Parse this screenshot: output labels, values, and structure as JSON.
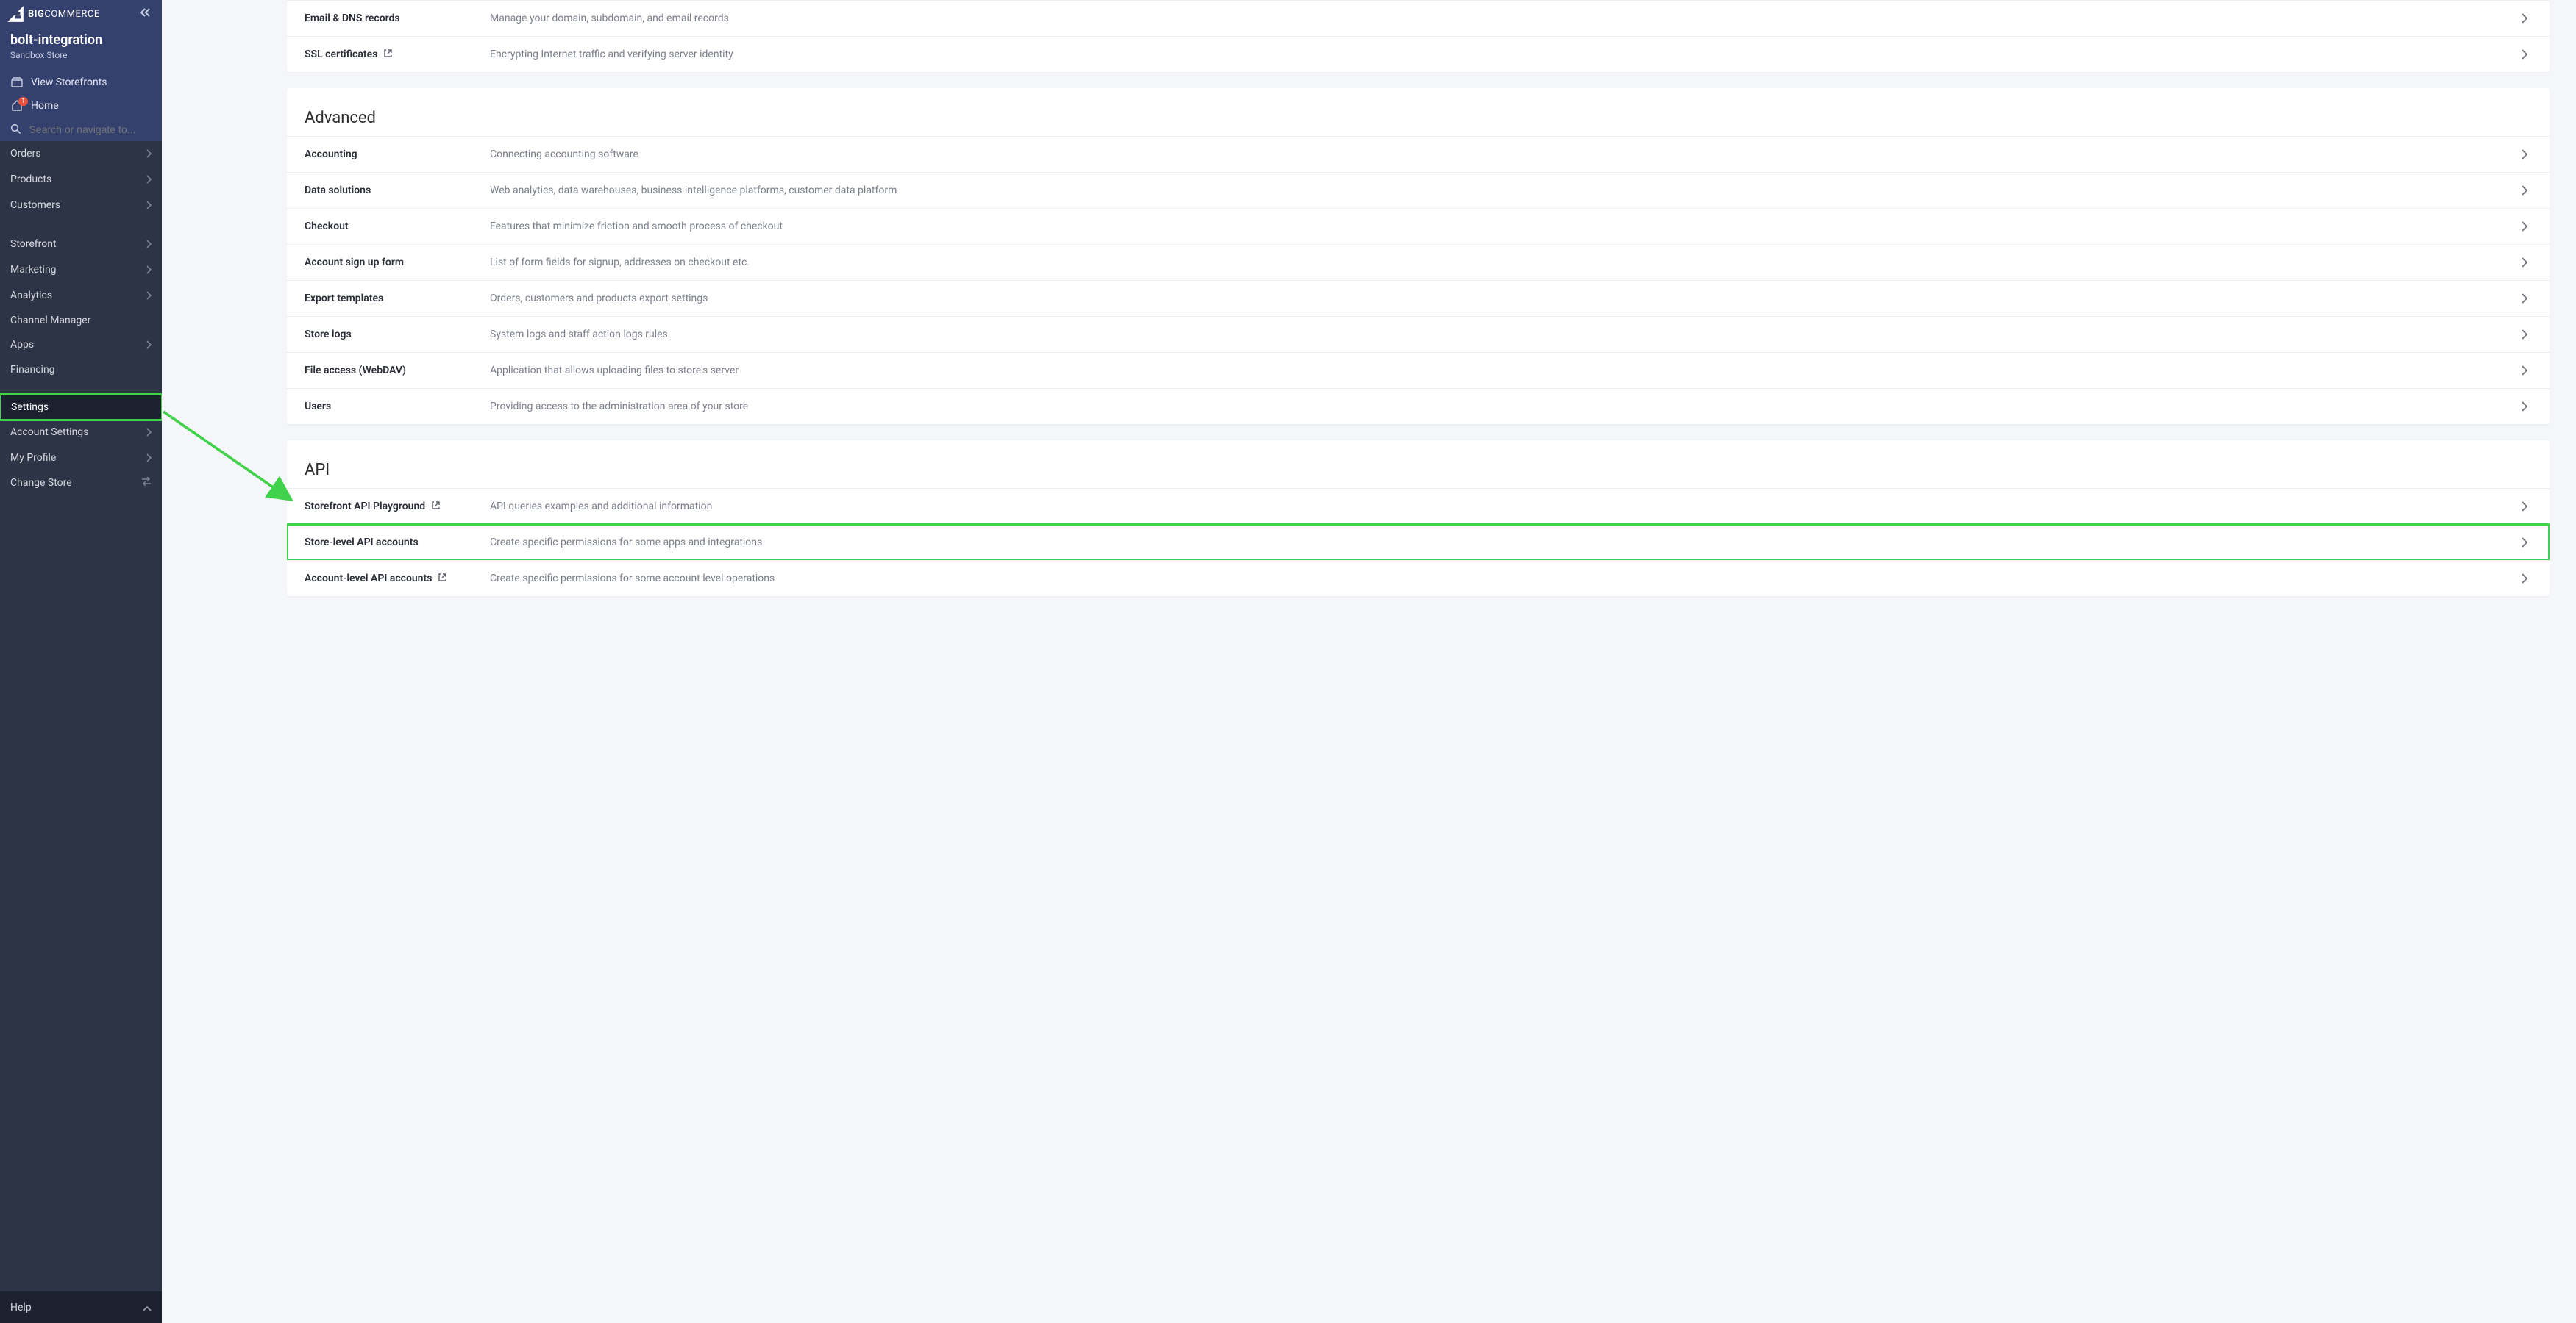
{
  "brand": {
    "name_part1": "BIG",
    "name_part2": "COMMERCE"
  },
  "store": {
    "name": "bolt-integration",
    "subtitle": "Sandbox Store"
  },
  "top_links": {
    "view_storefronts": "View Storefronts",
    "home": "Home",
    "home_badge": "1",
    "search_placeholder": "Search or navigate to..."
  },
  "nav": {
    "groups": [
      {
        "items": [
          {
            "label": "Orders",
            "chev": true
          },
          {
            "label": "Products",
            "chev": true
          },
          {
            "label": "Customers",
            "chev": true
          }
        ]
      },
      {
        "items": [
          {
            "label": "Storefront",
            "chev": true
          },
          {
            "label": "Marketing",
            "chev": true
          },
          {
            "label": "Analytics",
            "chev": true
          },
          {
            "label": "Channel Manager",
            "chev": false
          },
          {
            "label": "Apps",
            "chev": true
          },
          {
            "label": "Financing",
            "chev": false
          }
        ]
      },
      {
        "items": [
          {
            "label": "Settings",
            "chev": false,
            "active": true
          },
          {
            "label": "Account Settings",
            "chev": true
          },
          {
            "label": "My Profile",
            "chev": true
          },
          {
            "label": "Change Store",
            "swap": true
          }
        ]
      }
    ]
  },
  "footer": {
    "help": "Help"
  },
  "sections": [
    {
      "title": "",
      "rows": [
        {
          "label": "Email & DNS records",
          "desc": "Manage your domain, subdomain, and email records"
        },
        {
          "label": "SSL certificates",
          "ext": true,
          "desc": "Encrypting Internet traffic and verifying server identity"
        }
      ]
    },
    {
      "title": "Advanced",
      "rows": [
        {
          "label": "Accounting",
          "desc": "Connecting accounting software"
        },
        {
          "label": "Data solutions",
          "desc": "Web analytics, data warehouses, business intelligence platforms, customer data platform"
        },
        {
          "label": "Checkout",
          "desc": "Features that minimize friction and smooth process of checkout"
        },
        {
          "label": "Account sign up form",
          "desc": "List of form fields for signup, addresses on checkout etc."
        },
        {
          "label": "Export templates",
          "desc": "Orders, customers and products export settings"
        },
        {
          "label": "Store logs",
          "desc": "System logs and staff action logs rules"
        },
        {
          "label": "File access (WebDAV)",
          "desc": "Application that allows uploading files to store's server"
        },
        {
          "label": "Users",
          "desc": "Providing access to the administration area of your store"
        }
      ]
    },
    {
      "title": "API",
      "rows": [
        {
          "label": "Storefront API Playground",
          "ext": true,
          "desc": "API queries examples and additional information"
        },
        {
          "label": "Store-level API accounts",
          "desc": "Create specific permissions for some apps and integrations",
          "highlight": true
        },
        {
          "label": "Account-level API accounts",
          "ext": true,
          "desc": "Create specific permissions for some account level operations"
        }
      ]
    }
  ],
  "annotations": {
    "settings_highlight_color": "#3fd24a",
    "row_highlight_color": "#3fd24a"
  }
}
